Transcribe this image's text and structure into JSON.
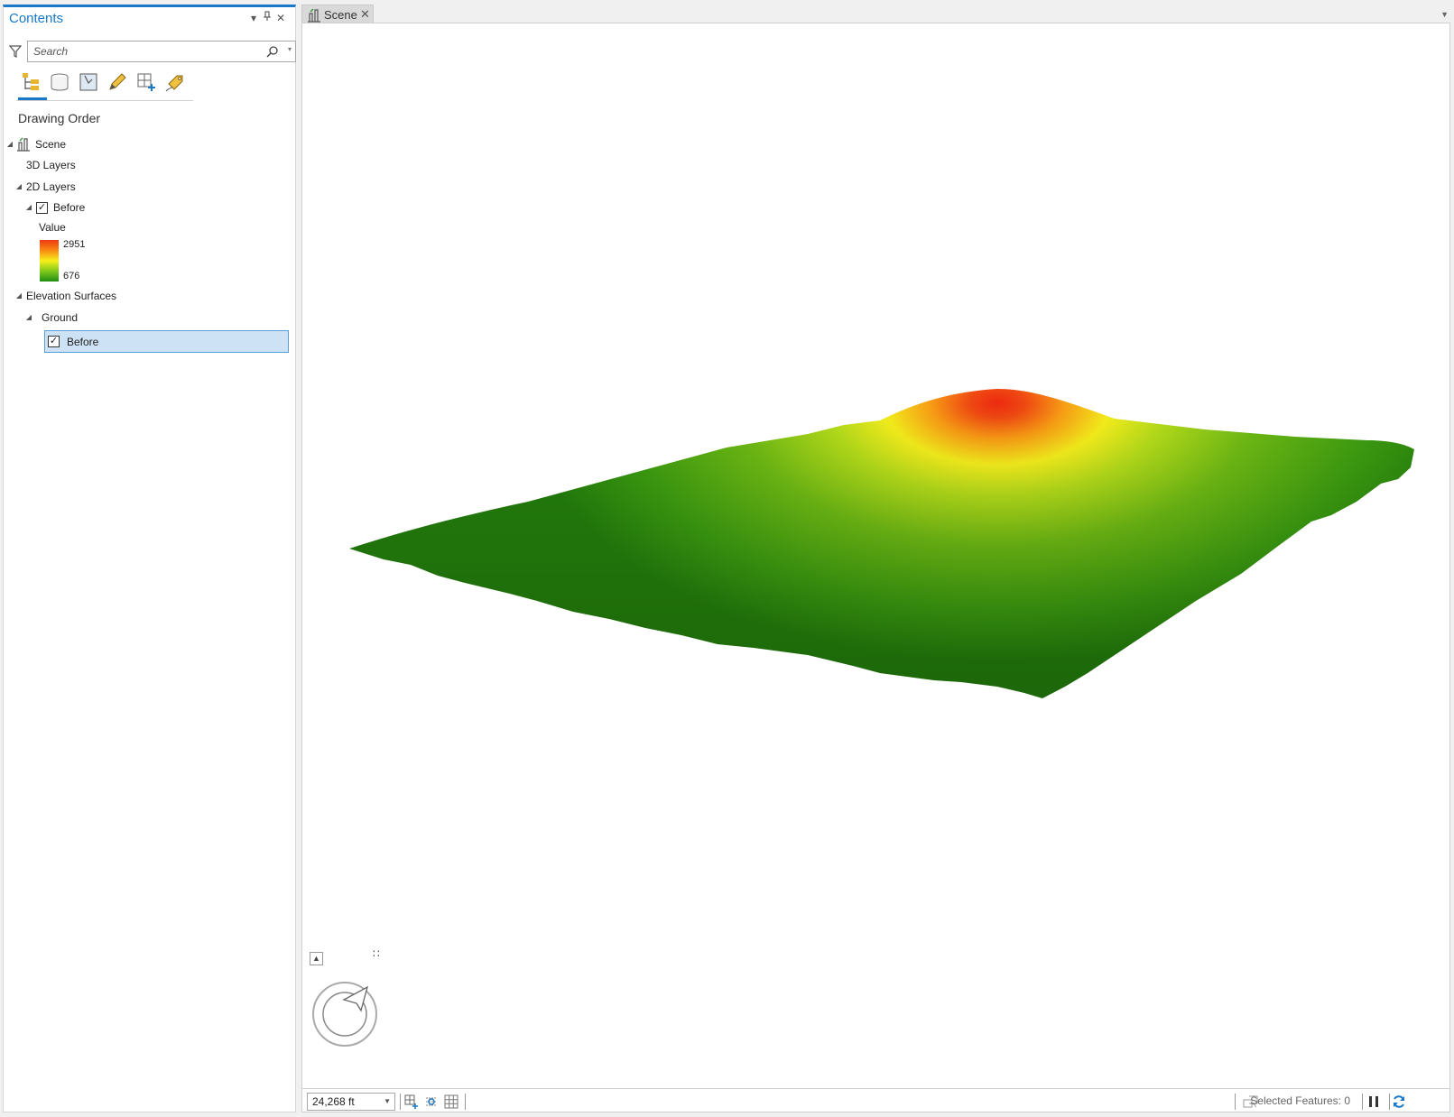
{
  "contents": {
    "title": "Contents",
    "search_placeholder": "Search",
    "section_title": "Drawing Order",
    "tree": {
      "scene": "Scene",
      "layers_3d": "3D Layers",
      "layers_2d": "2D Layers",
      "before_layer": "Before",
      "legend_title": "Value",
      "legend_high": "2951",
      "legend_low": "676",
      "elevation_surfaces": "Elevation Surfaces",
      "ground": "Ground",
      "before_surface": "Before"
    },
    "view_tabs": [
      "list-by-drawing-order-icon",
      "list-by-data-source-icon",
      "list-by-selection-icon",
      "list-by-editing-icon",
      "list-by-snapping-icon",
      "list-by-labeling-icon"
    ]
  },
  "scene_tab": {
    "label": "Scene"
  },
  "status_bar": {
    "scale": "24,268 ft",
    "selected_features": "Selected Features: 0"
  },
  "colors": {
    "accent": "#1979c8",
    "selection": "#cde2f5",
    "elevation_high": "#ee3a12",
    "elevation_mid": "#f6f01a",
    "elevation_low": "#1f8e12"
  }
}
